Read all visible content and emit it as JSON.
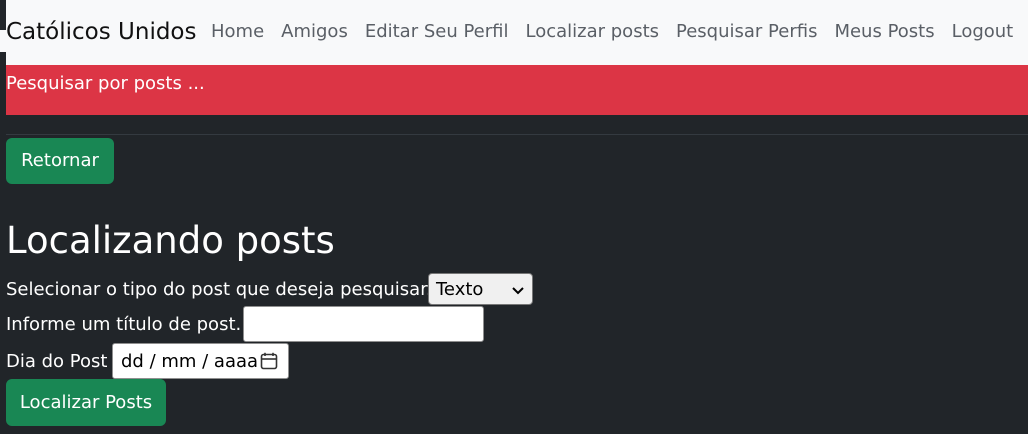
{
  "navbar": {
    "brand": "Católicos Unidos",
    "links": [
      "Home",
      "Amigos",
      "Editar Seu Perfil",
      "Localizar posts",
      "Pesquisar Perfis",
      "Meus Posts",
      "Logout"
    ]
  },
  "alert": {
    "text": "Pesquisar por posts ..."
  },
  "return_button": "Retornar",
  "page_title": "Localizando posts",
  "form": {
    "type_label": "Selecionar o tipo do post que deseja pesquisar.",
    "type_selected": "Texto",
    "title_label": "Informe um título de post.",
    "title_value": "",
    "date_label": "Dia do Post",
    "date_placeholder": "dd / mm / aaaa",
    "submit_label": "Localizar Posts"
  },
  "colors": {
    "background": "#212529",
    "navbar": "#f8f9fa",
    "alert": "#dc3545",
    "button": "#198754"
  },
  "icons": {
    "select": "chevron-down-icon",
    "date": "calendar-icon"
  }
}
